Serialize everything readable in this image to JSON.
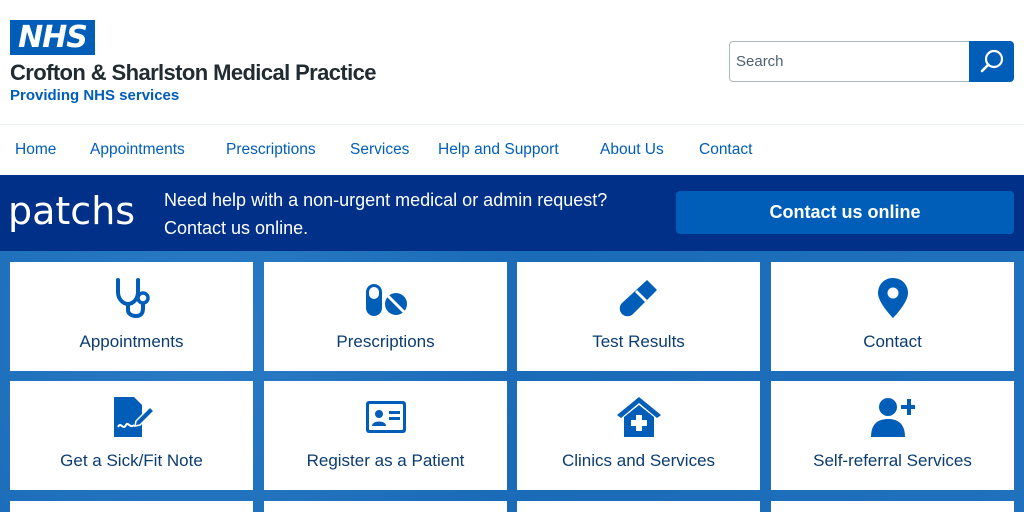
{
  "header": {
    "logo_text": "NHS",
    "practice_name": "Crofton & Sharlston Medical Practice",
    "practice_sub": "Providing NHS services"
  },
  "search": {
    "placeholder": "Search"
  },
  "nav": {
    "items": [
      "Home",
      "Appointments",
      "Prescriptions",
      "Services",
      "Help and Support",
      "About Us",
      "Contact"
    ]
  },
  "banner": {
    "logo_text": "patchs",
    "message": "Need help with a non-urgent medical or admin request? Contact us online.",
    "button_label": "Contact us online"
  },
  "tiles": [
    {
      "label": "Appointments",
      "icon": "stethoscope-icon"
    },
    {
      "label": "Prescriptions",
      "icon": "pills-icon"
    },
    {
      "label": "Test Results",
      "icon": "test-tube-icon"
    },
    {
      "label": "Contact",
      "icon": "map-pin-icon"
    },
    {
      "label": "Get a Sick/Fit Note",
      "icon": "signature-document-icon"
    },
    {
      "label": "Register as a Patient",
      "icon": "id-card-icon"
    },
    {
      "label": "Clinics and Services",
      "icon": "medical-house-icon"
    },
    {
      "label": "Self-referral Services",
      "icon": "add-user-icon"
    }
  ],
  "colors": {
    "nhs_blue": "#005eb8",
    "dark_blue": "#003087",
    "text_dark": "#212b32",
    "tile_text": "#0b3c70"
  }
}
